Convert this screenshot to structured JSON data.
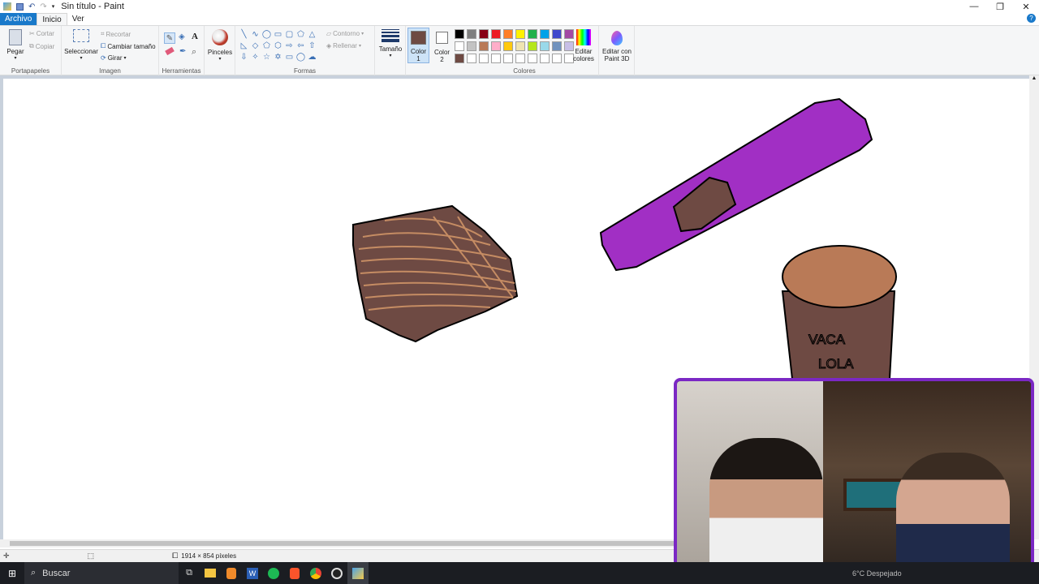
{
  "window": {
    "title": "Sin título - Paint"
  },
  "tabs": [
    {
      "label": "Archivo"
    },
    {
      "label": "Inicio"
    },
    {
      "label": "Ver"
    }
  ],
  "ribbon": {
    "clipboard": {
      "paste": "Pegar",
      "cut": "Cortar",
      "copy": "Copiar",
      "label": "Portapapeles"
    },
    "image": {
      "select": "Seleccionar",
      "crop": "Recortar",
      "resize": "Cambiar tamaño",
      "rotate": "Girar",
      "label": "Imagen"
    },
    "tools": {
      "label": "Herramientas"
    },
    "brushes": {
      "label": "Pinceles"
    },
    "shapes": {
      "outline": "Contorno",
      "fill": "Rellenar",
      "label": "Formas"
    },
    "size": {
      "label": "Tamaño"
    },
    "color1": {
      "label1": "Color",
      "label2": "1",
      "value": "#6e4a43"
    },
    "color2": {
      "label1": "Color",
      "label2": "2",
      "value": "#ffffff"
    },
    "colors": {
      "label": "Colores",
      "row1": [
        "#000000",
        "#7f7f7f",
        "#880015",
        "#ed1c24",
        "#ff7f27",
        "#fff200",
        "#22b14c",
        "#00a2e8",
        "#3f48cc",
        "#a349a4"
      ],
      "row2": [
        "#ffffff",
        "#c3c3c3",
        "#b97a57",
        "#ffaec9",
        "#ffc90e",
        "#efe4b0",
        "#b5e61d",
        "#99d9ea",
        "#7092be",
        "#c8bfe7"
      ],
      "row3": [
        "#6e4a43",
        "#ffffff",
        "#ffffff",
        "#ffffff",
        "#ffffff",
        "#ffffff",
        "#ffffff",
        "#ffffff",
        "#ffffff",
        "#ffffff"
      ]
    },
    "edit_colors": {
      "l1": "Editar",
      "l2": "colores"
    },
    "paint3d": {
      "l1": "Editar con",
      "l2": "Paint 3D"
    }
  },
  "canvas": {
    "drawing_text_1": "VACA",
    "drawing_text_2": "LOLA"
  },
  "status": {
    "dimensions": "1914 × 854 píxeles"
  },
  "taskbar": {
    "search_placeholder": "Buscar",
    "weather": "6°C Despejado"
  }
}
